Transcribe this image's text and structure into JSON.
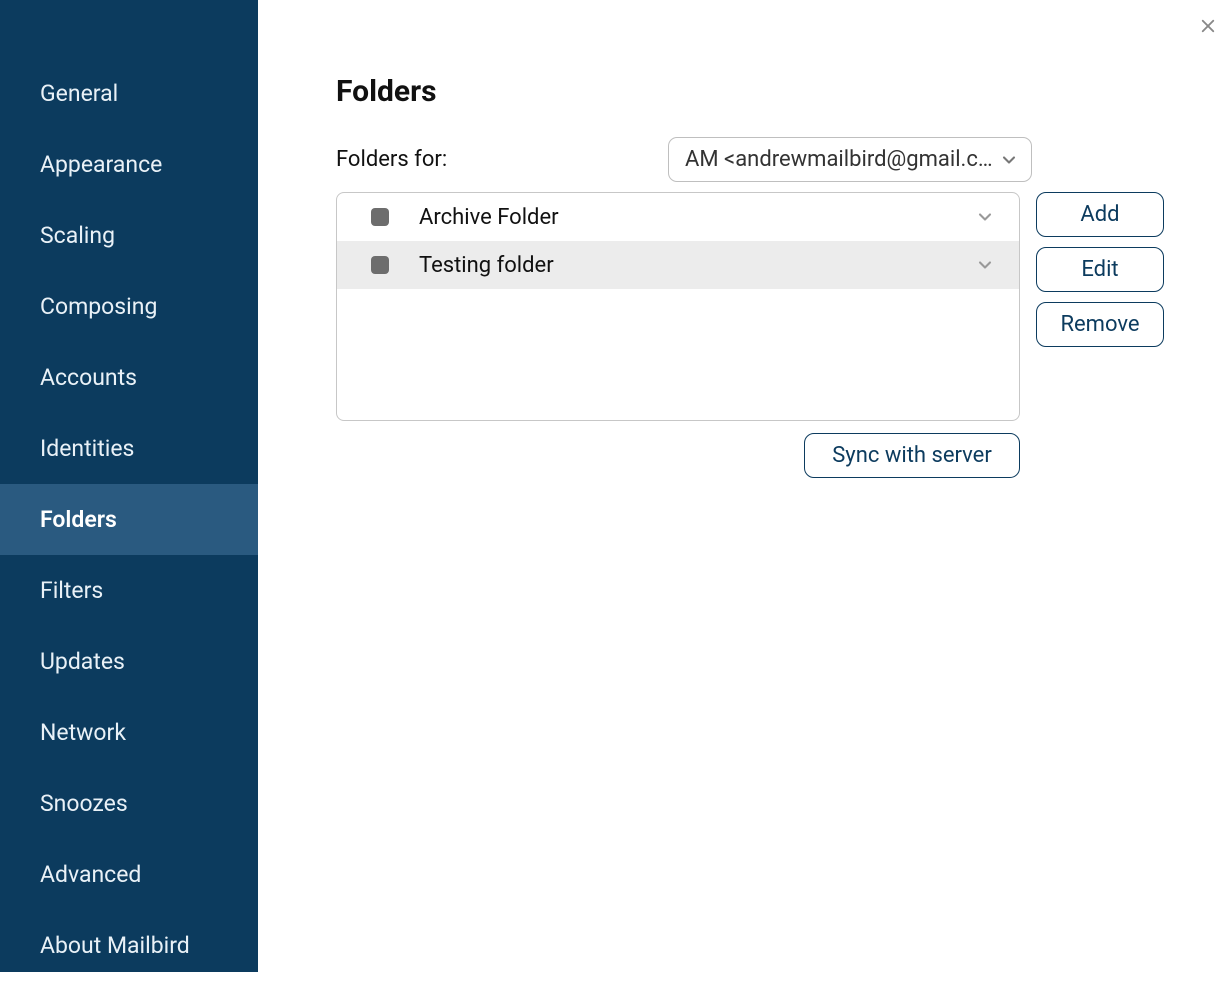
{
  "sidebar": {
    "items": [
      {
        "label": "General"
      },
      {
        "label": "Appearance"
      },
      {
        "label": "Scaling"
      },
      {
        "label": "Composing"
      },
      {
        "label": "Accounts"
      },
      {
        "label": "Identities"
      },
      {
        "label": "Folders"
      },
      {
        "label": "Filters"
      },
      {
        "label": "Updates"
      },
      {
        "label": "Network"
      },
      {
        "label": "Snoozes"
      },
      {
        "label": "Advanced"
      },
      {
        "label": "About Mailbird"
      }
    ],
    "active_index": 6
  },
  "main": {
    "title": "Folders",
    "folders_for_label": "Folders for:",
    "account_selected": "AM <andrewmailbird@gmail.c…",
    "folders": [
      {
        "name": "Archive Folder",
        "selected": false
      },
      {
        "name": "Testing folder",
        "selected": true
      }
    ],
    "buttons": {
      "add": "Add",
      "edit": "Edit",
      "remove": "Remove",
      "sync": "Sync with server"
    }
  }
}
